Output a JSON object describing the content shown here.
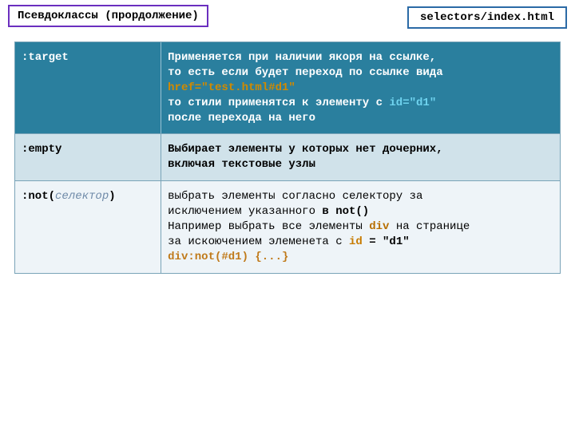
{
  "header": {
    "title": "Псевдоклассы (прордолжение)",
    "path": "selectors/index.html"
  },
  "rows": [
    {
      "name": ":target",
      "desc_line1": "Применяется при наличии якоря на ссылке,",
      "desc_line2": "то есть если будет переход по ссылке вида",
      "href_token": "href=\"test.html#d1\"",
      "desc_line3a": "то стили применятся к элементу c ",
      "id_token": "id=\"d1\"",
      "desc_line4": "после перехода на него"
    },
    {
      "name": ":empty",
      "desc_line1": "Выбирает элементы у которых нет дочерних,",
      "desc_line2": "включая текстовые узлы"
    },
    {
      "not_prefix": ":not(",
      "not_param": "селектор",
      "not_suffix": ")",
      "desc_line1": "выбрать элементы согласно селектору за",
      "desc_line2a": "исключением  указанного ",
      "desc_line2b": "в not()",
      "desc_line3a": "Например выбрать все элементы ",
      "div_token": "div",
      "desc_line3b": " на странице",
      "desc_line4a": "за искоючением элеменета с  ",
      "id_label": "id",
      "eq": " = ",
      "id_val": "\"d1\"",
      "code": "div:not(#d1) {...}"
    }
  ]
}
